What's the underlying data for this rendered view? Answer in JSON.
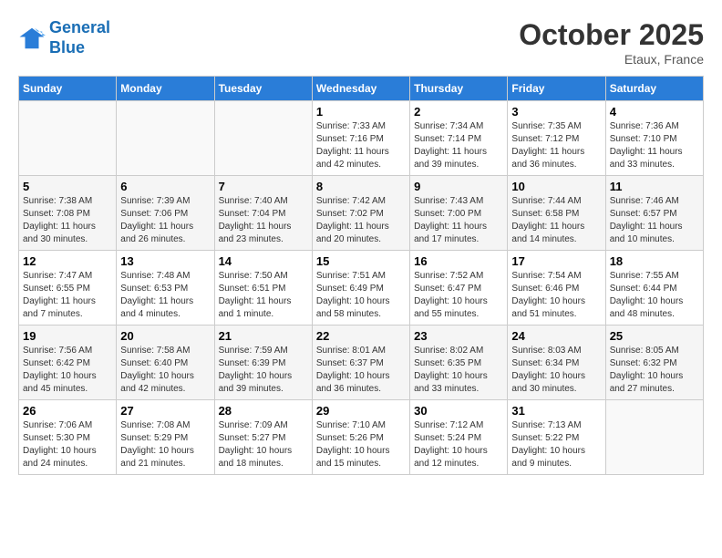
{
  "header": {
    "logo_line1": "General",
    "logo_line2": "Blue",
    "month": "October 2025",
    "location": "Etaux, France"
  },
  "weekdays": [
    "Sunday",
    "Monday",
    "Tuesday",
    "Wednesday",
    "Thursday",
    "Friday",
    "Saturday"
  ],
  "weeks": [
    [
      {
        "day": "",
        "sunrise": "",
        "sunset": "",
        "daylight": ""
      },
      {
        "day": "",
        "sunrise": "",
        "sunset": "",
        "daylight": ""
      },
      {
        "day": "",
        "sunrise": "",
        "sunset": "",
        "daylight": ""
      },
      {
        "day": "1",
        "sunrise": "Sunrise: 7:33 AM",
        "sunset": "Sunset: 7:16 PM",
        "daylight": "Daylight: 11 hours and 42 minutes."
      },
      {
        "day": "2",
        "sunrise": "Sunrise: 7:34 AM",
        "sunset": "Sunset: 7:14 PM",
        "daylight": "Daylight: 11 hours and 39 minutes."
      },
      {
        "day": "3",
        "sunrise": "Sunrise: 7:35 AM",
        "sunset": "Sunset: 7:12 PM",
        "daylight": "Daylight: 11 hours and 36 minutes."
      },
      {
        "day": "4",
        "sunrise": "Sunrise: 7:36 AM",
        "sunset": "Sunset: 7:10 PM",
        "daylight": "Daylight: 11 hours and 33 minutes."
      }
    ],
    [
      {
        "day": "5",
        "sunrise": "Sunrise: 7:38 AM",
        "sunset": "Sunset: 7:08 PM",
        "daylight": "Daylight: 11 hours and 30 minutes."
      },
      {
        "day": "6",
        "sunrise": "Sunrise: 7:39 AM",
        "sunset": "Sunset: 7:06 PM",
        "daylight": "Daylight: 11 hours and 26 minutes."
      },
      {
        "day": "7",
        "sunrise": "Sunrise: 7:40 AM",
        "sunset": "Sunset: 7:04 PM",
        "daylight": "Daylight: 11 hours and 23 minutes."
      },
      {
        "day": "8",
        "sunrise": "Sunrise: 7:42 AM",
        "sunset": "Sunset: 7:02 PM",
        "daylight": "Daylight: 11 hours and 20 minutes."
      },
      {
        "day": "9",
        "sunrise": "Sunrise: 7:43 AM",
        "sunset": "Sunset: 7:00 PM",
        "daylight": "Daylight: 11 hours and 17 minutes."
      },
      {
        "day": "10",
        "sunrise": "Sunrise: 7:44 AM",
        "sunset": "Sunset: 6:58 PM",
        "daylight": "Daylight: 11 hours and 14 minutes."
      },
      {
        "day": "11",
        "sunrise": "Sunrise: 7:46 AM",
        "sunset": "Sunset: 6:57 PM",
        "daylight": "Daylight: 11 hours and 10 minutes."
      }
    ],
    [
      {
        "day": "12",
        "sunrise": "Sunrise: 7:47 AM",
        "sunset": "Sunset: 6:55 PM",
        "daylight": "Daylight: 11 hours and 7 minutes."
      },
      {
        "day": "13",
        "sunrise": "Sunrise: 7:48 AM",
        "sunset": "Sunset: 6:53 PM",
        "daylight": "Daylight: 11 hours and 4 minutes."
      },
      {
        "day": "14",
        "sunrise": "Sunrise: 7:50 AM",
        "sunset": "Sunset: 6:51 PM",
        "daylight": "Daylight: 11 hours and 1 minute."
      },
      {
        "day": "15",
        "sunrise": "Sunrise: 7:51 AM",
        "sunset": "Sunset: 6:49 PM",
        "daylight": "Daylight: 10 hours and 58 minutes."
      },
      {
        "day": "16",
        "sunrise": "Sunrise: 7:52 AM",
        "sunset": "Sunset: 6:47 PM",
        "daylight": "Daylight: 10 hours and 55 minutes."
      },
      {
        "day": "17",
        "sunrise": "Sunrise: 7:54 AM",
        "sunset": "Sunset: 6:46 PM",
        "daylight": "Daylight: 10 hours and 51 minutes."
      },
      {
        "day": "18",
        "sunrise": "Sunrise: 7:55 AM",
        "sunset": "Sunset: 6:44 PM",
        "daylight": "Daylight: 10 hours and 48 minutes."
      }
    ],
    [
      {
        "day": "19",
        "sunrise": "Sunrise: 7:56 AM",
        "sunset": "Sunset: 6:42 PM",
        "daylight": "Daylight: 10 hours and 45 minutes."
      },
      {
        "day": "20",
        "sunrise": "Sunrise: 7:58 AM",
        "sunset": "Sunset: 6:40 PM",
        "daylight": "Daylight: 10 hours and 42 minutes."
      },
      {
        "day": "21",
        "sunrise": "Sunrise: 7:59 AM",
        "sunset": "Sunset: 6:39 PM",
        "daylight": "Daylight: 10 hours and 39 minutes."
      },
      {
        "day": "22",
        "sunrise": "Sunrise: 8:01 AM",
        "sunset": "Sunset: 6:37 PM",
        "daylight": "Daylight: 10 hours and 36 minutes."
      },
      {
        "day": "23",
        "sunrise": "Sunrise: 8:02 AM",
        "sunset": "Sunset: 6:35 PM",
        "daylight": "Daylight: 10 hours and 33 minutes."
      },
      {
        "day": "24",
        "sunrise": "Sunrise: 8:03 AM",
        "sunset": "Sunset: 6:34 PM",
        "daylight": "Daylight: 10 hours and 30 minutes."
      },
      {
        "day": "25",
        "sunrise": "Sunrise: 8:05 AM",
        "sunset": "Sunset: 6:32 PM",
        "daylight": "Daylight: 10 hours and 27 minutes."
      }
    ],
    [
      {
        "day": "26",
        "sunrise": "Sunrise: 7:06 AM",
        "sunset": "Sunset: 5:30 PM",
        "daylight": "Daylight: 10 hours and 24 minutes."
      },
      {
        "day": "27",
        "sunrise": "Sunrise: 7:08 AM",
        "sunset": "Sunset: 5:29 PM",
        "daylight": "Daylight: 10 hours and 21 minutes."
      },
      {
        "day": "28",
        "sunrise": "Sunrise: 7:09 AM",
        "sunset": "Sunset: 5:27 PM",
        "daylight": "Daylight: 10 hours and 18 minutes."
      },
      {
        "day": "29",
        "sunrise": "Sunrise: 7:10 AM",
        "sunset": "Sunset: 5:26 PM",
        "daylight": "Daylight: 10 hours and 15 minutes."
      },
      {
        "day": "30",
        "sunrise": "Sunrise: 7:12 AM",
        "sunset": "Sunset: 5:24 PM",
        "daylight": "Daylight: 10 hours and 12 minutes."
      },
      {
        "day": "31",
        "sunrise": "Sunrise: 7:13 AM",
        "sunset": "Sunset: 5:22 PM",
        "daylight": "Daylight: 10 hours and 9 minutes."
      },
      {
        "day": "",
        "sunrise": "",
        "sunset": "",
        "daylight": ""
      }
    ]
  ]
}
